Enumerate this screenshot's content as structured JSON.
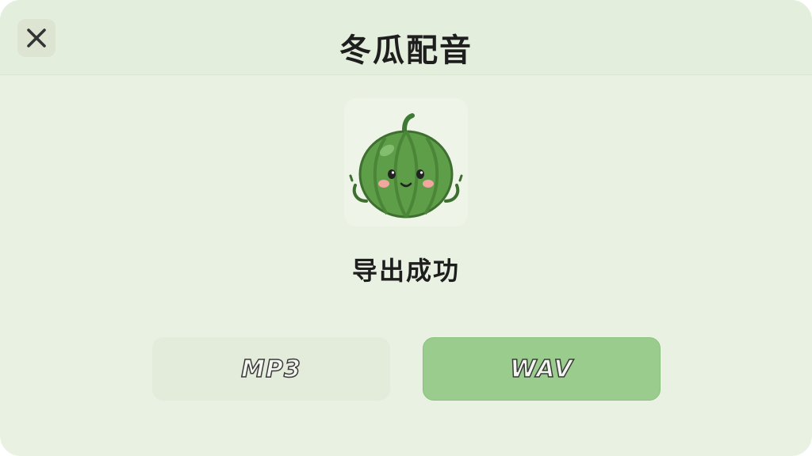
{
  "dialog": {
    "title": "冬瓜配音",
    "close_icon": "close-icon",
    "mascot_icon": "winter-melon-mascot-icon",
    "status_text": "导出成功"
  },
  "formats": {
    "mp3_label": "MP3",
    "wav_label": "WAV"
  },
  "colors": {
    "background": "#e9f2e2",
    "accent_selected": "#99cc8d",
    "melon_green": "#5f9e48"
  }
}
